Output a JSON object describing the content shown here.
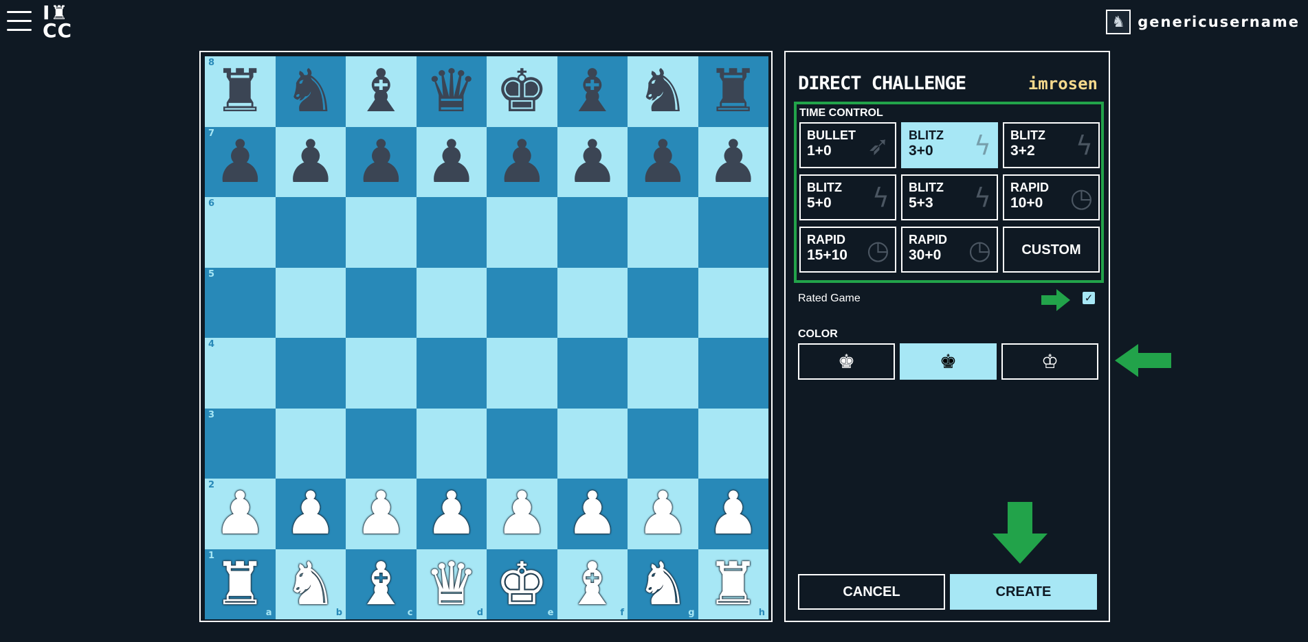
{
  "header": {
    "logo_line1": "I♜",
    "logo_line2": "CC",
    "username": "genericusername"
  },
  "board": {
    "ranks": [
      "8",
      "7",
      "6",
      "5",
      "4",
      "3",
      "2",
      "1"
    ],
    "files": [
      "a",
      "b",
      "c",
      "d",
      "e",
      "f",
      "g",
      "h"
    ],
    "pieces": [
      [
        "♜",
        "♞",
        "♝",
        "♛",
        "♚",
        "♝",
        "♞",
        "♜"
      ],
      [
        "♟",
        "♟",
        "♟",
        "♟",
        "♟",
        "♟",
        "♟",
        "♟"
      ],
      [
        "",
        "",
        "",
        "",
        "",
        "",
        "",
        ""
      ],
      [
        "",
        "",
        "",
        "",
        "",
        "",
        "",
        ""
      ],
      [
        "",
        "",
        "",
        "",
        "",
        "",
        "",
        ""
      ],
      [
        "",
        "",
        "",
        "",
        "",
        "",
        "",
        ""
      ],
      [
        "♟",
        "♟",
        "♟",
        "♟",
        "♟",
        "♟",
        "♟",
        "♟"
      ],
      [
        "♜",
        "♞",
        "♝",
        "♛",
        "♚",
        "♝",
        "♞",
        "♜"
      ]
    ],
    "light_color": "#a7e7f5",
    "dark_color": "#2889b8"
  },
  "panel": {
    "title": "DIRECT CHALLENGE",
    "opponent": "imrosen",
    "time_control_label": "TIME CONTROL",
    "time_controls": [
      {
        "name": "BULLET",
        "time": "1+0",
        "icon": "rocket-icon",
        "selected": false
      },
      {
        "name": "BLITZ",
        "time": "3+0",
        "icon": "lightning-icon",
        "selected": true
      },
      {
        "name": "BLITZ",
        "time": "3+2",
        "icon": "lightning-icon",
        "selected": false
      },
      {
        "name": "BLITZ",
        "time": "5+0",
        "icon": "lightning-icon",
        "selected": false
      },
      {
        "name": "BLITZ",
        "time": "5+3",
        "icon": "lightning-icon",
        "selected": false
      },
      {
        "name": "RAPID",
        "time": "10+0",
        "icon": "clock-icon",
        "selected": false
      },
      {
        "name": "RAPID",
        "time": "15+10",
        "icon": "clock-icon",
        "selected": false
      },
      {
        "name": "RAPID",
        "time": "30+0",
        "icon": "clock-icon",
        "selected": false
      }
    ],
    "custom_label": "CUSTOM",
    "rated_label": "Rated Game",
    "rated_checked": true,
    "color_label": "COLOR",
    "color_options": [
      "white-king-icon",
      "random-king-icon",
      "black-king-icon"
    ],
    "color_selected": 1,
    "cancel_label": "CANCEL",
    "create_label": "CREATE"
  },
  "annotation_color": "#22a34a"
}
